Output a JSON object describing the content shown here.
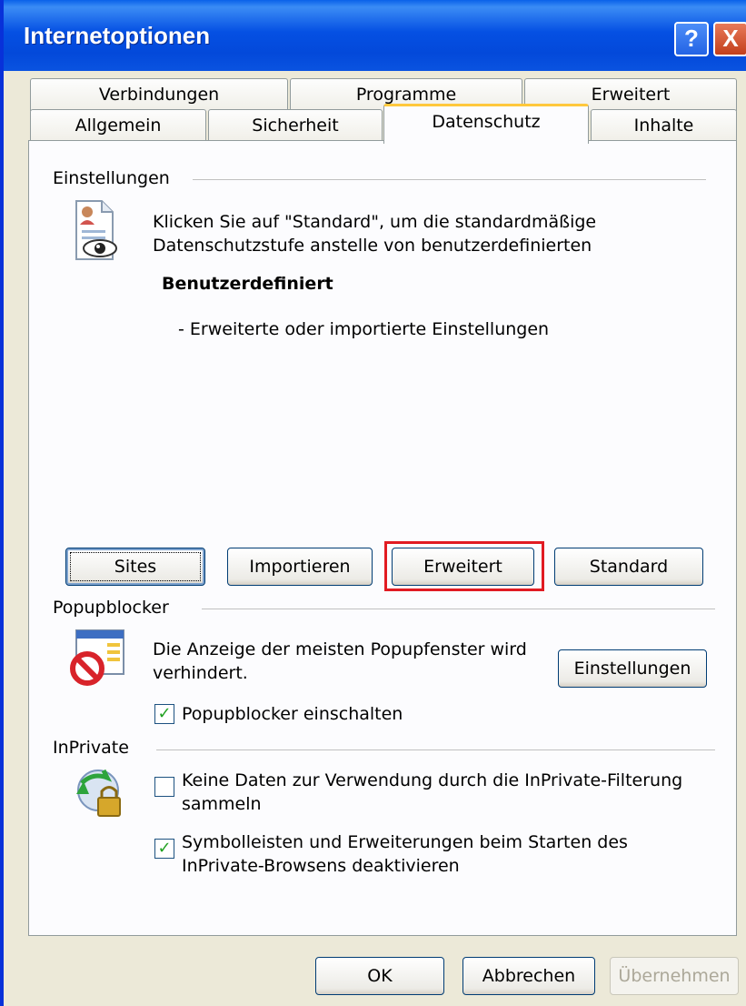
{
  "window": {
    "title": "Internetoptionen",
    "help_glyph": "?",
    "close_glyph": "X"
  },
  "tabs": {
    "row1": [
      "Verbindungen",
      "Programme",
      "Erweitert"
    ],
    "row2": [
      "Allgemein",
      "Sicherheit",
      "Datenschutz",
      "Inhalte"
    ],
    "active": "Datenschutz"
  },
  "settings": {
    "group_label": "Einstellungen",
    "description_line1": "Klicken Sie auf \"Standard\", um die standardmäßige",
    "description_line2": "Datenschutzstufe anstelle von benutzerdefinierten",
    "level_name": "Benutzerdefiniert",
    "level_detail": "- Erweiterte oder importierte Einstellungen",
    "buttons": {
      "sites": "Sites",
      "import": "Importieren",
      "advanced": "Erweitert",
      "default": "Standard"
    }
  },
  "popup": {
    "group_label": "Popupblocker",
    "description_line1": "Die Anzeige der meisten Popupfenster wird",
    "description_line2": "verhindert.",
    "settings_button": "Einstellungen",
    "checkbox_label": "Popupblocker einschalten",
    "checkbox_checked": true
  },
  "inprivate": {
    "group_label": "InPrivate",
    "option1_line1": "Keine Daten zur Verwendung durch die InPrivate-Filterung",
    "option1_line2": "sammeln",
    "option1_checked": false,
    "option2_line1": "Symbolleisten und Erweiterungen beim Starten des",
    "option2_line2": "InPrivate-Browsens deaktivieren",
    "option2_checked": true
  },
  "footer": {
    "ok": "OK",
    "cancel": "Abbrechen",
    "apply": "Übernehmen"
  },
  "colors": {
    "titlebar": "#0550e3",
    "highlight": "#e11b22",
    "check": "#21a121"
  }
}
